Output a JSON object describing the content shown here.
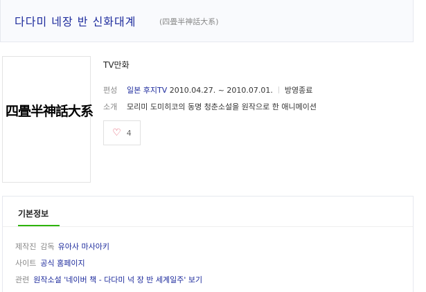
{
  "header": {
    "title": "다다미 네장 반 신화대계",
    "original_title": "(四畳半神話大系)"
  },
  "poster": {
    "text": "四畳半神話大系"
  },
  "info": {
    "category": "TV만화",
    "schedule_label": "편성",
    "schedule_network": "일본 후지TV",
    "schedule_period": "2010.04.27. ~ 2010.07.01.",
    "schedule_status": "방영종료",
    "intro_label": "소개",
    "intro_text": "모리미 도미히코의 동명 청춘소설을 원작으로 한 애니메이션"
  },
  "like": {
    "count": "4"
  },
  "basic": {
    "tab_label": "기본정보",
    "producer_label": "제작진",
    "director_sublabel": "감독",
    "director_name": "유아사 마사아키",
    "site_label": "사이트",
    "site_link": "공식 홈페이지",
    "related_label": "관련",
    "related_link": "원작소설 '네이버 책 - 다다미 넉 장 반 세계일주' 보기"
  },
  "colors": {
    "title": "#1c2a9c",
    "link": "#1c2a9c",
    "accent_green": "#2db400",
    "heart": "#e04a5f"
  }
}
